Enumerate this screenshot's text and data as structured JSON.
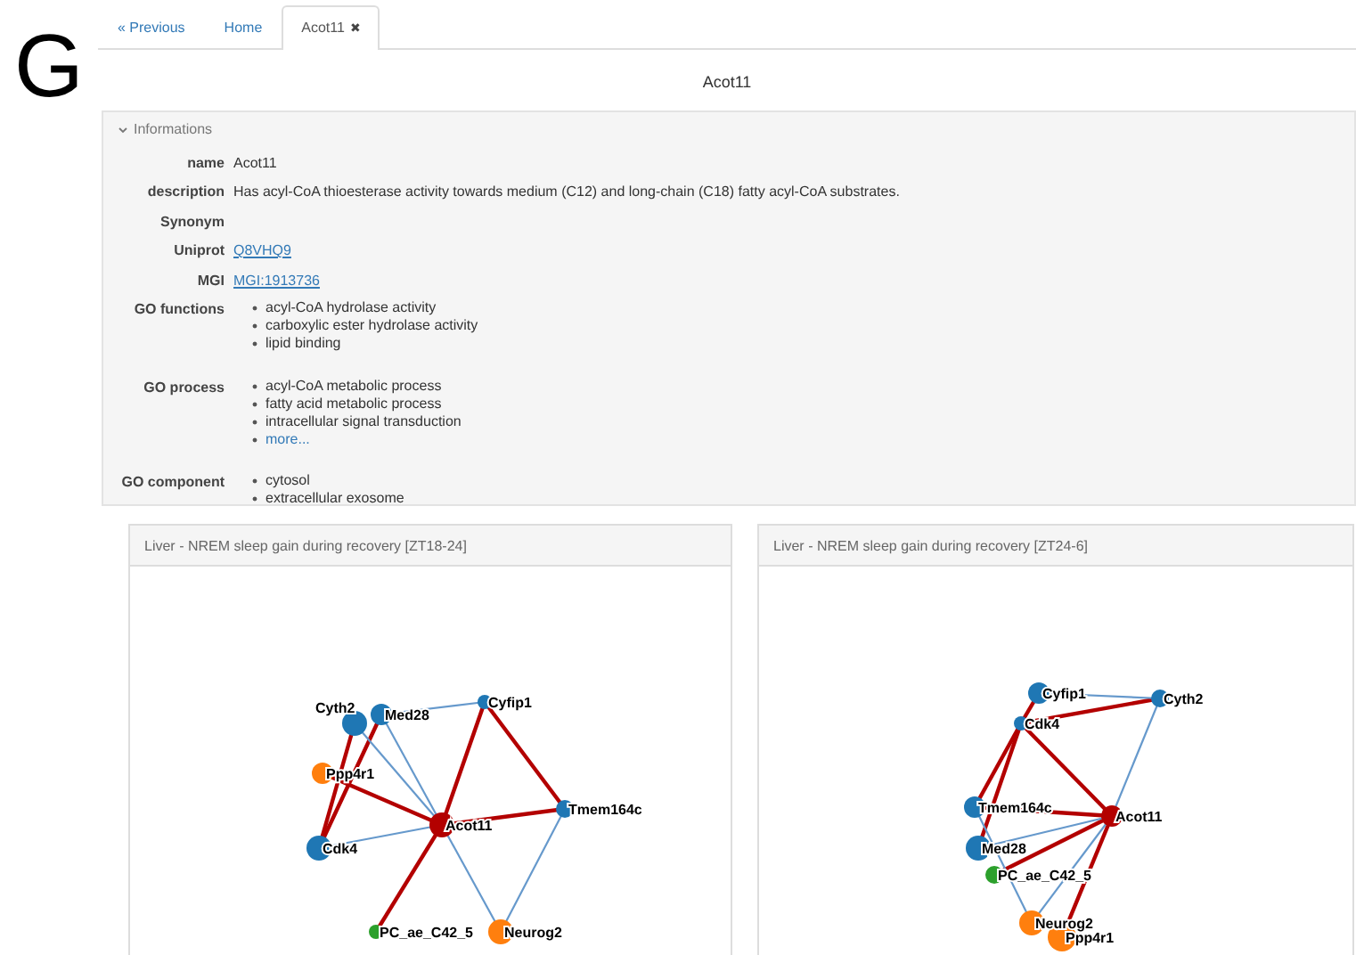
{
  "panel_letter": "G",
  "tabs": [
    {
      "label": "« Previous",
      "selected": false,
      "closable": false
    },
    {
      "label": "Home",
      "selected": false,
      "closable": false
    },
    {
      "label": "Acot11",
      "selected": true,
      "closable": true,
      "close_glyph": "✖"
    }
  ],
  "page_title": "Acot11",
  "info": {
    "heading": "Informations",
    "expanded": true,
    "fields": [
      {
        "label": "name",
        "kind": "text",
        "value": "Acot11"
      },
      {
        "label": "description",
        "kind": "text",
        "value": "Has acyl-CoA thioesterase activity towards medium (C12) and long-chain (C18) fatty acyl-CoA substrates."
      },
      {
        "label": "Synonym",
        "kind": "text"
      },
      {
        "label": "Uniprot",
        "kind": "link",
        "value": "Q8VHQ9"
      },
      {
        "label": "MGI",
        "kind": "link",
        "value": "MGI:1913736"
      },
      {
        "label": "GO functions",
        "kind": "list",
        "items": [
          {
            "text": "acyl-CoA hydrolase activity",
            "kind": "text"
          },
          {
            "text": "carboxylic ester hydrolase activity",
            "kind": "text"
          },
          {
            "text": "lipid binding",
            "kind": "text"
          }
        ]
      },
      {
        "label": "GO process",
        "kind": "list",
        "items": [
          {
            "text": "acyl-CoA metabolic process",
            "kind": "text"
          },
          {
            "text": "fatty acid metabolic process",
            "kind": "text"
          },
          {
            "text": "intracellular signal transduction",
            "kind": "text"
          },
          {
            "text": "more...",
            "kind": "link"
          }
        ]
      },
      {
        "label": "GO component",
        "kind": "list",
        "items": [
          {
            "text": "cytosol",
            "kind": "text"
          },
          {
            "text": "extracellular exosome",
            "kind": "text"
          }
        ]
      }
    ]
  },
  "networks": [
    {
      "title": "Liver - NREM sleep gain during recovery [ZT18-24]",
      "nodes": [
        {
          "label": "Cyth2",
          "color": "#1f77b4"
        },
        {
          "label": "Med28",
          "color": "#1f77b4"
        },
        {
          "label": "Cyfip1",
          "color": "#1f77b4"
        },
        {
          "label": "Ppp4r1",
          "color": "#ff7f0e"
        },
        {
          "label": "Acot11",
          "color": "#b30000"
        },
        {
          "label": "Tmem164c",
          "color": "#1f77b4"
        },
        {
          "label": "Cdk4",
          "color": "#1f77b4"
        },
        {
          "label": "PC_ae_C42_5",
          "color": "#2ca02c"
        },
        {
          "label": "Neurog2",
          "color": "#ff7f0e"
        }
      ],
      "edges": [
        {
          "color": "#b30000"
        },
        {
          "color": "#b30000"
        },
        {
          "color": "#b30000"
        },
        {
          "color": "#b30000"
        },
        {
          "color": "#b30000"
        },
        {
          "color": "#b30000"
        },
        {
          "color": "#b30000"
        },
        {
          "color": "#6699cc"
        },
        {
          "color": "#6699cc"
        },
        {
          "color": "#6699cc"
        },
        {
          "color": "#6699cc"
        },
        {
          "color": "#6699cc"
        },
        {
          "color": "#6699cc"
        }
      ]
    },
    {
      "title": "Liver - NREM sleep gain during recovery [ZT24-6]",
      "nodes": [
        {
          "label": "Cyfip1",
          "color": "#1f77b4"
        },
        {
          "label": "Cyth2",
          "color": "#1f77b4"
        },
        {
          "label": "Cdk4",
          "color": "#1f77b4"
        },
        {
          "label": "Tmem164c",
          "color": "#1f77b4"
        },
        {
          "label": "Acot11",
          "color": "#b30000"
        },
        {
          "label": "Med28",
          "color": "#1f77b4"
        },
        {
          "label": "PC_ae_C42_5",
          "color": "#2ca02c"
        },
        {
          "label": "Neurog2",
          "color": "#ff7f0e"
        },
        {
          "label": "Ppp4r1",
          "color": "#ff7f0e"
        }
      ],
      "edges": [
        {
          "color": "#b30000"
        },
        {
          "color": "#b30000"
        },
        {
          "color": "#b30000"
        },
        {
          "color": "#b30000"
        },
        {
          "color": "#b30000"
        },
        {
          "color": "#b30000"
        },
        {
          "color": "#b30000"
        },
        {
          "color": "#b30000"
        },
        {
          "color": "#6699cc"
        },
        {
          "color": "#6699cc"
        },
        {
          "color": "#6699cc"
        },
        {
          "color": "#6699cc"
        },
        {
          "color": "#6699cc"
        }
      ]
    }
  ]
}
